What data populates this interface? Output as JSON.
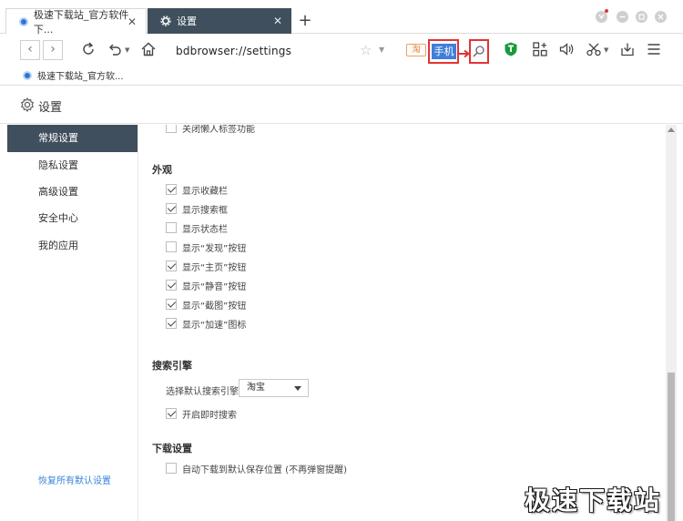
{
  "tabs": [
    {
      "label": "极速下载站_官方软件下..."
    },
    {
      "label": "设置"
    }
  ],
  "new_tab_label": "+",
  "address": "bdbrowser://settings",
  "search": {
    "text": "手机"
  },
  "bookmarks": [
    {
      "label": "极速下载站_官方软..."
    }
  ],
  "page": {
    "title": "设置"
  },
  "sidebar": {
    "items": [
      {
        "label": "常规设置"
      },
      {
        "label": "隐私设置"
      },
      {
        "label": "高级设置"
      },
      {
        "label": "安全中心"
      },
      {
        "label": "我的应用"
      }
    ],
    "restore_link": "恢复所有默认设置"
  },
  "content": {
    "cutoff_row": {
      "label": "关闭懒人标签功能",
      "checked": false
    },
    "appearance": {
      "title": "外观",
      "options": [
        {
          "label": "显示收藏栏",
          "checked": true
        },
        {
          "label": "显示搜索框",
          "checked": true
        },
        {
          "label": "显示状态栏",
          "checked": false
        },
        {
          "label": "显示“发现”按钮",
          "checked": false
        },
        {
          "label": "显示“主页”按钮",
          "checked": true
        },
        {
          "label": "显示“静音”按钮",
          "checked": true
        },
        {
          "label": "显示“截图”按钮",
          "checked": true
        },
        {
          "label": "显示“加速”图标",
          "checked": true
        }
      ]
    },
    "search_engine": {
      "title": "搜索引擎",
      "default_label": "选择默认搜索引擎",
      "selected": "淘宝",
      "instant_search": {
        "label": "开启即时搜索",
        "checked": true
      }
    },
    "download": {
      "title": "下载设置",
      "auto_save": {
        "label": "自动下载到默认保存位置 (不再弹窗提醒)",
        "checked": false
      }
    }
  },
  "watermark": "极速下载站",
  "colors": {
    "active_tab": "#3f4f5d",
    "sidebar_active": "#3f4f5d",
    "highlight_red": "#e23434",
    "search_text_bg": "#3f7fd9",
    "link": "#3a84d6"
  }
}
